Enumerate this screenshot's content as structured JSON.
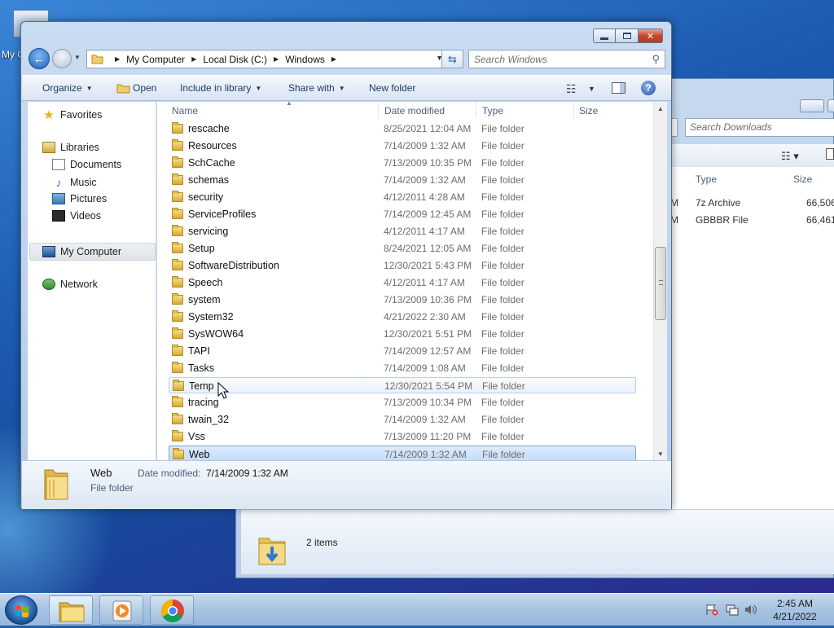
{
  "desktop": {
    "icon_label": "My C"
  },
  "background_window": {
    "search_placeholder": "Search Downloads",
    "columns": {
      "type": "Type",
      "size": "Size"
    },
    "rows": [
      {
        "m": "M",
        "type": "7z Archive",
        "size": "66,506"
      },
      {
        "m": "M",
        "type": "GBBBR File",
        "size": "66,461"
      }
    ],
    "items_count": "2 items"
  },
  "window": {
    "breadcrumbs": [
      "My Computer",
      "Local Disk (C:)",
      "Windows"
    ],
    "search_placeholder": "Search Windows",
    "toolbar": {
      "organize": "Organize",
      "open": "Open",
      "include_in_library": "Include in library",
      "share_with": "Share with",
      "new_folder": "New folder"
    },
    "nav": {
      "favorites": "Favorites",
      "libraries": "Libraries",
      "documents": "Documents",
      "music": "Music",
      "pictures": "Pictures",
      "videos": "Videos",
      "my_computer": "My Computer",
      "network": "Network"
    },
    "columns": {
      "name": "Name",
      "date_modified": "Date modified",
      "type": "Type",
      "size": "Size"
    },
    "files": [
      {
        "name": "rescache",
        "date": "8/25/2021 12:04 AM",
        "type": "File folder"
      },
      {
        "name": "Resources",
        "date": "7/14/2009 1:32 AM",
        "type": "File folder"
      },
      {
        "name": "SchCache",
        "date": "7/13/2009 10:35 PM",
        "type": "File folder"
      },
      {
        "name": "schemas",
        "date": "7/14/2009 1:32 AM",
        "type": "File folder"
      },
      {
        "name": "security",
        "date": "4/12/2011 4:28 AM",
        "type": "File folder"
      },
      {
        "name": "ServiceProfiles",
        "date": "7/14/2009 12:45 AM",
        "type": "File folder"
      },
      {
        "name": "servicing",
        "date": "4/12/2011 4:17 AM",
        "type": "File folder"
      },
      {
        "name": "Setup",
        "date": "8/24/2021 12:05 AM",
        "type": "File folder"
      },
      {
        "name": "SoftwareDistribution",
        "date": "12/30/2021 5:43 PM",
        "type": "File folder"
      },
      {
        "name": "Speech",
        "date": "4/12/2011 4:17 AM",
        "type": "File folder"
      },
      {
        "name": "system",
        "date": "7/13/2009 10:36 PM",
        "type": "File folder"
      },
      {
        "name": "System32",
        "date": "4/21/2022 2:30 AM",
        "type": "File folder"
      },
      {
        "name": "SysWOW64",
        "date": "12/30/2021 5:51 PM",
        "type": "File folder"
      },
      {
        "name": "TAPI",
        "date": "7/14/2009 12:57 AM",
        "type": "File folder"
      },
      {
        "name": "Tasks",
        "date": "7/14/2009 1:08 AM",
        "type": "File folder"
      },
      {
        "name": "Temp",
        "date": "12/30/2021 5:54 PM",
        "type": "File folder"
      },
      {
        "name": "tracing",
        "date": "7/13/2009 10:34 PM",
        "type": "File folder"
      },
      {
        "name": "twain_32",
        "date": "7/14/2009 1:32 AM",
        "type": "File folder"
      },
      {
        "name": "Vss",
        "date": "7/13/2009 11:20 PM",
        "type": "File folder"
      },
      {
        "name": "Web",
        "date": "7/14/2009 1:32 AM",
        "type": "File folder"
      }
    ],
    "hovered_row": "Temp",
    "selected_row": "Web",
    "details": {
      "name": "Web",
      "date_label": "Date modified:",
      "date": "7/14/2009 1:32 AM",
      "type": "File folder"
    }
  },
  "taskbar": {
    "time": "2:45 AM",
    "date": "4/21/2022"
  },
  "colors": {
    "selection": "#c1dcfc",
    "selection_border": "#7da2ce",
    "window_frame": "#b4cbe6",
    "taskbar": "#a6c3e2"
  }
}
